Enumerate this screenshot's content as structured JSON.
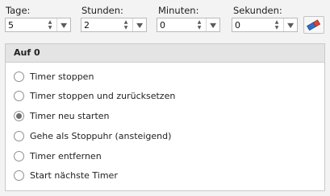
{
  "fields": [
    {
      "label": "Tage:",
      "value": "5"
    },
    {
      "label": "Stunden:",
      "value": "2"
    },
    {
      "label": "Minuten:",
      "value": "0"
    },
    {
      "label": "Sekunden:",
      "value": "0"
    }
  ],
  "erase_button": {
    "icon": "eraser-icon"
  },
  "group": {
    "title": "Auf 0",
    "options": [
      {
        "label": "Timer stoppen",
        "selected": false
      },
      {
        "label": "Timer stoppen und zurücksetzen",
        "selected": false
      },
      {
        "label": "Timer neu starten",
        "selected": true
      },
      {
        "label": "Gehe als Stoppuhr (ansteigend)",
        "selected": false
      },
      {
        "label": "Timer entfernen",
        "selected": false
      },
      {
        "label": "Start nächste Timer",
        "selected": false
      }
    ]
  },
  "colors": {
    "accent_blue": "#2f6fc4",
    "accent_red": "#d9453b"
  }
}
